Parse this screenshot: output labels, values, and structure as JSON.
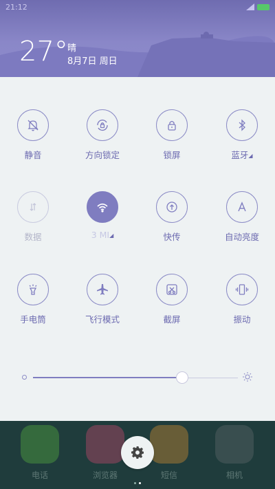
{
  "status_bar": {
    "time": "21:12",
    "battery_color": "#57c86a"
  },
  "weather": {
    "temperature": "27°",
    "condition": "晴",
    "date": "8月7日 周日"
  },
  "toggles": [
    {
      "label": "静音",
      "icon": "bell-off-icon",
      "state": "off"
    },
    {
      "label": "方向锁定",
      "icon": "rotation-lock-icon",
      "state": "off"
    },
    {
      "label": "锁屏",
      "icon": "lock-icon",
      "state": "off"
    },
    {
      "label": "蓝牙",
      "icon": "bluetooth-icon",
      "state": "off",
      "has_more": true
    },
    {
      "label": "数据",
      "icon": "mobile-data-icon",
      "state": "disabled"
    },
    {
      "label": "3 MI",
      "icon": "wifi-icon",
      "state": "on",
      "has_more": true
    },
    {
      "label": "快传",
      "icon": "quick-transfer-icon",
      "state": "off"
    },
    {
      "label": "自动亮度",
      "icon": "auto-brightness-icon",
      "state": "off"
    },
    {
      "label": "手电筒",
      "icon": "flashlight-icon",
      "state": "off"
    },
    {
      "label": "飞行模式",
      "icon": "airplane-icon",
      "state": "off"
    },
    {
      "label": "截屏",
      "icon": "screenshot-icon",
      "state": "off"
    },
    {
      "label": "振动",
      "icon": "vibrate-icon",
      "state": "off"
    }
  ],
  "brightness": {
    "level": 0.7
  },
  "dock": [
    {
      "label": "电话",
      "icon": "phone-icon"
    },
    {
      "label": "浏览器",
      "icon": "browser-icon"
    },
    {
      "label": "短信",
      "icon": "messages-icon"
    },
    {
      "label": "相机",
      "icon": "camera-icon"
    }
  ],
  "colors": {
    "accent": "#7f7dc0",
    "header": "#8a87c8",
    "panel": "#eef2f3"
  },
  "page_indicator": {
    "pages": 2,
    "current": 2
  }
}
